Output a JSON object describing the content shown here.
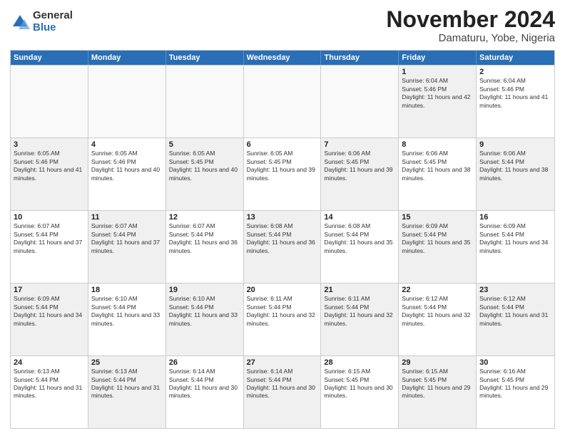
{
  "logo": {
    "general": "General",
    "blue": "Blue"
  },
  "title": "November 2024",
  "location": "Damaturu, Yobe, Nigeria",
  "header_days": [
    "Sunday",
    "Monday",
    "Tuesday",
    "Wednesday",
    "Thursday",
    "Friday",
    "Saturday"
  ],
  "rows": [
    [
      {
        "day": "",
        "text": "",
        "empty": true
      },
      {
        "day": "",
        "text": "",
        "empty": true
      },
      {
        "day": "",
        "text": "",
        "empty": true
      },
      {
        "day": "",
        "text": "",
        "empty": true
      },
      {
        "day": "",
        "text": "",
        "empty": true
      },
      {
        "day": "1",
        "text": "Sunrise: 6:04 AM\nSunset: 5:46 PM\nDaylight: 11 hours and 42 minutes.",
        "shaded": true
      },
      {
        "day": "2",
        "text": "Sunrise: 6:04 AM\nSunset: 5:46 PM\nDaylight: 11 hours and 41 minutes.",
        "shaded": false
      }
    ],
    [
      {
        "day": "3",
        "text": "Sunrise: 6:05 AM\nSunset: 5:46 PM\nDaylight: 11 hours and 41 minutes.",
        "shaded": true
      },
      {
        "day": "4",
        "text": "Sunrise: 6:05 AM\nSunset: 5:46 PM\nDaylight: 11 hours and 40 minutes.",
        "shaded": false
      },
      {
        "day": "5",
        "text": "Sunrise: 6:05 AM\nSunset: 5:45 PM\nDaylight: 11 hours and 40 minutes.",
        "shaded": true
      },
      {
        "day": "6",
        "text": "Sunrise: 6:05 AM\nSunset: 5:45 PM\nDaylight: 11 hours and 39 minutes.",
        "shaded": false
      },
      {
        "day": "7",
        "text": "Sunrise: 6:06 AM\nSunset: 5:45 PM\nDaylight: 11 hours and 39 minutes.",
        "shaded": true
      },
      {
        "day": "8",
        "text": "Sunrise: 6:06 AM\nSunset: 5:45 PM\nDaylight: 11 hours and 38 minutes.",
        "shaded": false
      },
      {
        "day": "9",
        "text": "Sunrise: 6:06 AM\nSunset: 5:44 PM\nDaylight: 11 hours and 38 minutes.",
        "shaded": true
      }
    ],
    [
      {
        "day": "10",
        "text": "Sunrise: 6:07 AM\nSunset: 5:44 PM\nDaylight: 11 hours and 37 minutes.",
        "shaded": false
      },
      {
        "day": "11",
        "text": "Sunrise: 6:07 AM\nSunset: 5:44 PM\nDaylight: 11 hours and 37 minutes.",
        "shaded": true
      },
      {
        "day": "12",
        "text": "Sunrise: 6:07 AM\nSunset: 5:44 PM\nDaylight: 11 hours and 36 minutes.",
        "shaded": false
      },
      {
        "day": "13",
        "text": "Sunrise: 6:08 AM\nSunset: 5:44 PM\nDaylight: 11 hours and 36 minutes.",
        "shaded": true
      },
      {
        "day": "14",
        "text": "Sunrise: 6:08 AM\nSunset: 5:44 PM\nDaylight: 11 hours and 35 minutes.",
        "shaded": false
      },
      {
        "day": "15",
        "text": "Sunrise: 6:09 AM\nSunset: 5:44 PM\nDaylight: 11 hours and 35 minutes.",
        "shaded": true
      },
      {
        "day": "16",
        "text": "Sunrise: 6:09 AM\nSunset: 5:44 PM\nDaylight: 11 hours and 34 minutes.",
        "shaded": false
      }
    ],
    [
      {
        "day": "17",
        "text": "Sunrise: 6:09 AM\nSunset: 5:44 PM\nDaylight: 11 hours and 34 minutes.",
        "shaded": true
      },
      {
        "day": "18",
        "text": "Sunrise: 6:10 AM\nSunset: 5:44 PM\nDaylight: 11 hours and 33 minutes.",
        "shaded": false
      },
      {
        "day": "19",
        "text": "Sunrise: 6:10 AM\nSunset: 5:44 PM\nDaylight: 11 hours and 33 minutes.",
        "shaded": true
      },
      {
        "day": "20",
        "text": "Sunrise: 6:11 AM\nSunset: 5:44 PM\nDaylight: 11 hours and 32 minutes.",
        "shaded": false
      },
      {
        "day": "21",
        "text": "Sunrise: 6:11 AM\nSunset: 5:44 PM\nDaylight: 11 hours and 32 minutes.",
        "shaded": true
      },
      {
        "day": "22",
        "text": "Sunrise: 6:12 AM\nSunset: 5:44 PM\nDaylight: 11 hours and 32 minutes.",
        "shaded": false
      },
      {
        "day": "23",
        "text": "Sunrise: 6:12 AM\nSunset: 5:44 PM\nDaylight: 11 hours and 31 minutes.",
        "shaded": true
      }
    ],
    [
      {
        "day": "24",
        "text": "Sunrise: 6:13 AM\nSunset: 5:44 PM\nDaylight: 11 hours and 31 minutes.",
        "shaded": false
      },
      {
        "day": "25",
        "text": "Sunrise: 6:13 AM\nSunset: 5:44 PM\nDaylight: 11 hours and 31 minutes.",
        "shaded": true
      },
      {
        "day": "26",
        "text": "Sunrise: 6:14 AM\nSunset: 5:44 PM\nDaylight: 11 hours and 30 minutes.",
        "shaded": false
      },
      {
        "day": "27",
        "text": "Sunrise: 6:14 AM\nSunset: 5:44 PM\nDaylight: 11 hours and 30 minutes.",
        "shaded": true
      },
      {
        "day": "28",
        "text": "Sunrise: 6:15 AM\nSunset: 5:45 PM\nDaylight: 11 hours and 30 minutes.",
        "shaded": false
      },
      {
        "day": "29",
        "text": "Sunrise: 6:15 AM\nSunset: 5:45 PM\nDaylight: 11 hours and 29 minutes.",
        "shaded": true
      },
      {
        "day": "30",
        "text": "Sunrise: 6:16 AM\nSunset: 5:45 PM\nDaylight: 11 hours and 29 minutes.",
        "shaded": false
      }
    ]
  ]
}
